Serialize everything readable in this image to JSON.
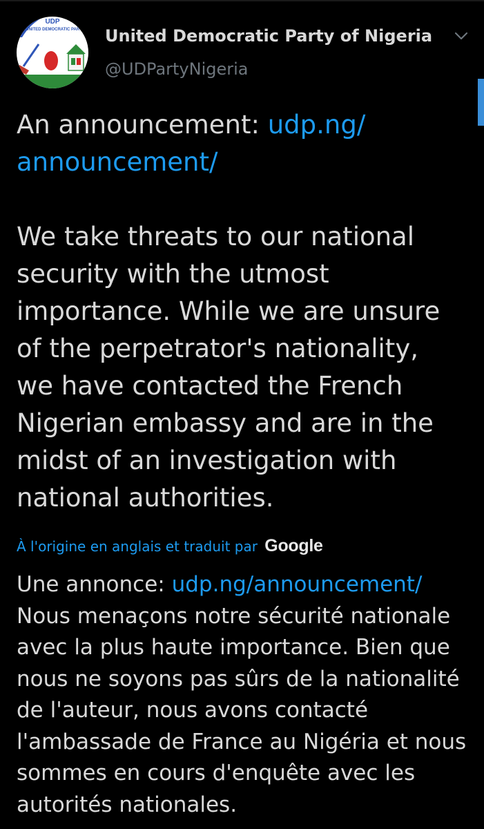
{
  "author": {
    "name": "United Democratic Party of Nigeria",
    "handle": "@UDPartyNigeria",
    "avatar_text": "UDP",
    "avatar_subtext": "UNITED DEMOCRATIC PARTY"
  },
  "tweet": {
    "intro": "An announcement: ",
    "link_part1": "udp.ng/",
    "link_part2": "announcement/",
    "body_lines": [
      "We take threats to our national",
      "security with the utmost",
      "importance. While we are unsure",
      "of the perpetrator's nationality,",
      "we have contacted the French",
      "Nigerian embassy and are in the",
      "midst of an investigation with",
      "national authorities."
    ]
  },
  "translation": {
    "attribution": "À l'origine en anglais et traduit par",
    "provider": "Google",
    "intro": "Une annonce: ",
    "link": "udp.ng/announcement/",
    "lines": [
      "Nous menaçons notre sécurité nationale",
      "avec la plus haute importance. Bien que",
      "nous ne soyons pas sûrs de la nationalité",
      "de l'auteur, nous avons contacté",
      "l'ambassade de France au Nigéria et nous",
      "sommes en cours d'enquête avec les",
      "autorités nationales."
    ]
  },
  "icons": {
    "menu": "chevron-down-icon"
  },
  "colors": {
    "background": "#000000",
    "text": "#d9d9d9",
    "secondary_text": "#6e767d",
    "link": "#1d9bf0",
    "scrollbar": "#3a8ed8"
  }
}
